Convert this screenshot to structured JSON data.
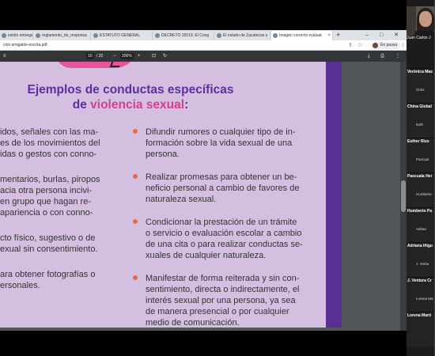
{
  "browser": {
    "tabs": [
      {
        "label": "estión entrega"
      },
      {
        "label": "reglamento_de_responsa"
      },
      {
        "label": "ESTATUTO GENERAL"
      },
      {
        "label": "DECRETO 15519. El Cong"
      },
      {
        "label": "El estado de Zacatecas s"
      },
      {
        "label": "Imagen correcto evaluat"
      }
    ],
    "new_tab_glyph": "+",
    "window_controls": "–  □  ✕",
    "url": "ción amigable-escrita.pdf",
    "pause_chip": "En pausa",
    "menu_glyph": "⋮"
  },
  "pdf_toolbar": {
    "menu_glyph": "≡",
    "page_current": "10",
    "page_total": "/ 20",
    "zoom_out": "−",
    "zoom_value": "200%",
    "zoom_in": "+",
    "fit_glyph": "⊡",
    "rotate_glyph": "↻",
    "download_glyph": "⤓",
    "print_glyph": "⎙",
    "more_glyph": "⋮"
  },
  "pdf": {
    "heading_line1": "Ejemplos de conductas específicas",
    "heading_pre": "de ",
    "heading_highlight": "violencia sexual",
    "heading_post": ":",
    "accent_color": "#d43f8d",
    "left_items": [
      "idos, señales con las ma-\nes de los movimientos del\nidas o gestos con conno-",
      "mentarios, burlas, piropos\nacia otra persona incivi-\nen grupo que hagan re-\napariencia o con conno-",
      "cto físico, sugestivo o de\nexual sin consentimiento.",
      "ara obtener fotografías o\nersonales."
    ],
    "right_items": [
      "Difundir rumores o cualquier tipo de in-\nformación sobre la vida sexual de una\npersona.",
      "Realizar promesas para obtener un be-\nneficio personal a cambio de favores de\nnaturaleza sexual.",
      "Condicionar la prestación de un trámite\no servicio o evaluación escolar a cambio\nde una cita o para realizar conductas se-\nxuales de cualquier naturaleza.",
      "Manifestar de forma reiterada y sin con-\nsentimiento, directa o indirectamente, el\ninterés sexual por una persona, ya sea\nde manera presencial o por cualquier\nmedio de comunicación."
    ]
  },
  "participants": {
    "featured_name": "Juan Carlos J",
    "tiles": [
      {
        "main": "Verónica Mas",
        "sub": "Chris"
      },
      {
        "main": "China Global",
        "sub": "Esth"
      },
      {
        "main": "Esther Rizo",
        "sub": "Pascual"
      },
      {
        "main": "Pascuala Her",
        "sub": "Humberto"
      },
      {
        "main": "Humberto Pa",
        "sub": "Adrian"
      },
      {
        "main": "Adriana Iñigu",
        "sub": "J. Ventu"
      },
      {
        "main": "J. Ventura Cr",
        "sub": "Lorena Ma"
      },
      {
        "main": "Lorena Martí",
        "sub": ""
      }
    ]
  }
}
